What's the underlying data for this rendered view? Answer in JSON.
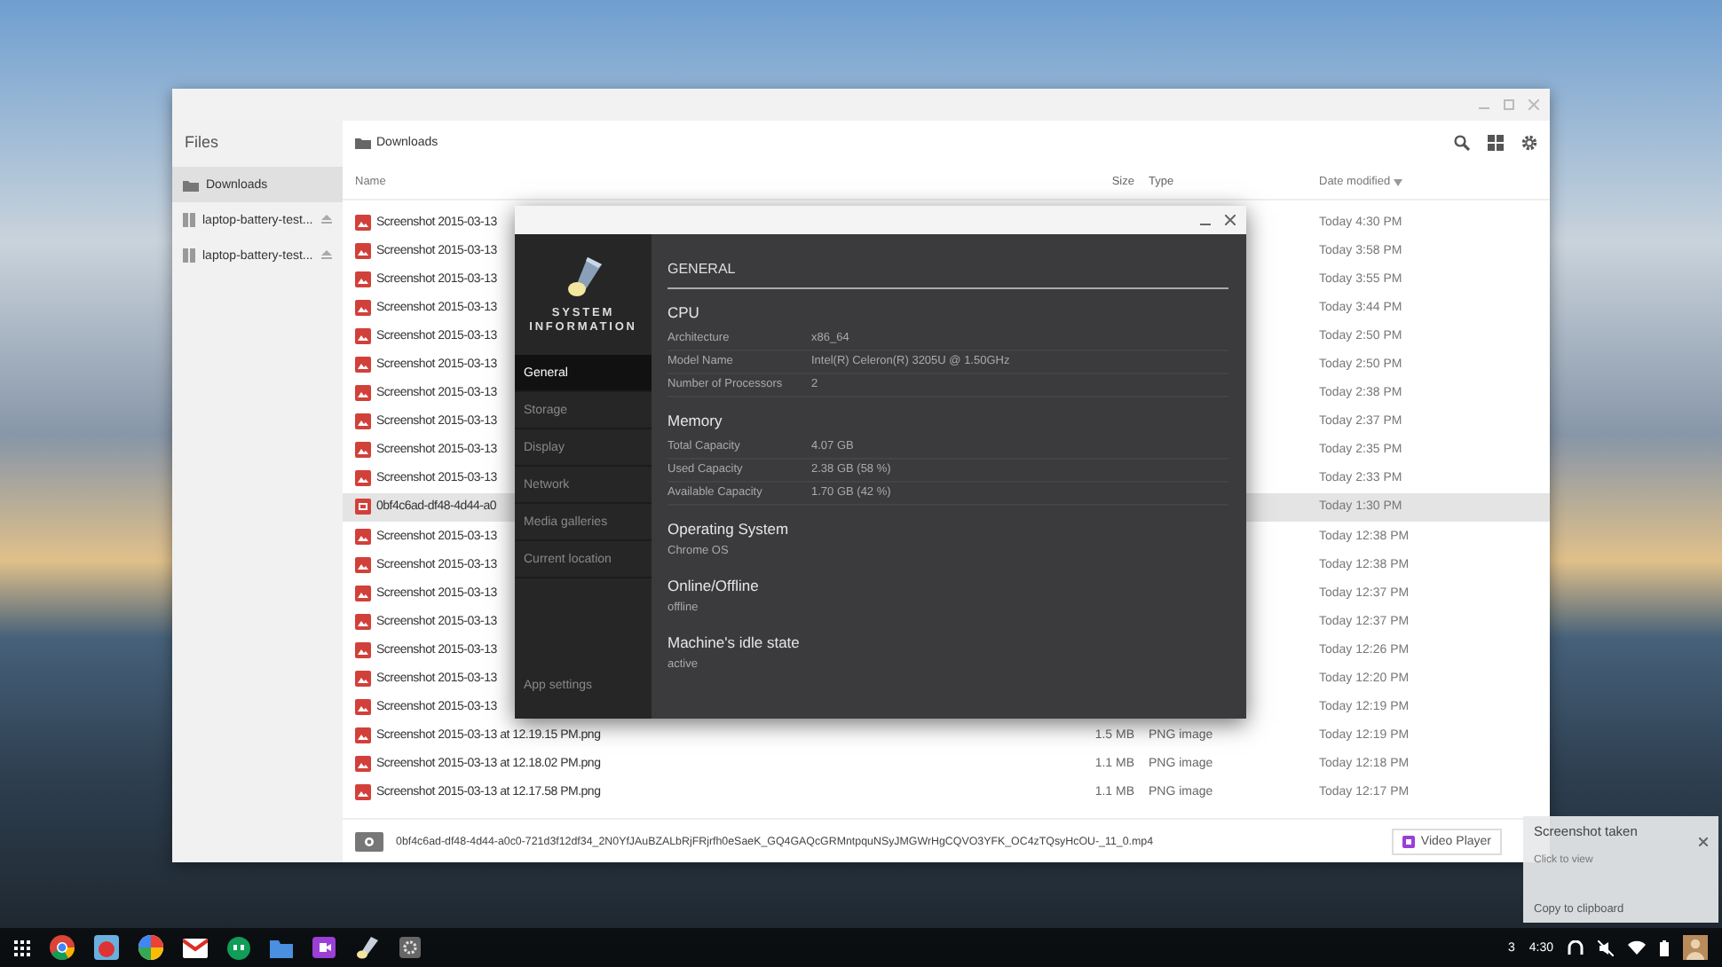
{
  "files_window": {
    "sidebar": {
      "title": "Files",
      "items": [
        {
          "label": "Downloads",
          "kind": "folder",
          "selected": true
        },
        {
          "label": "laptop-battery-test...",
          "kind": "drive",
          "selected": false
        },
        {
          "label": "laptop-battery-test...",
          "kind": "drive",
          "selected": false
        }
      ]
    },
    "breadcrumb": "Downloads",
    "columns": [
      "Name",
      "Size",
      "Type",
      "Date modified"
    ],
    "rows": [
      {
        "name": "Screenshot 2015-03-13",
        "kind": "image",
        "date": "Today 4:30 PM",
        "selected": false
      },
      {
        "name": "Screenshot 2015-03-13",
        "kind": "image",
        "date": "Today 3:58 PM",
        "selected": false
      },
      {
        "name": "Screenshot 2015-03-13",
        "kind": "image",
        "date": "Today 3:55 PM",
        "selected": false
      },
      {
        "name": "Screenshot 2015-03-13",
        "kind": "image",
        "date": "Today 3:44 PM",
        "selected": false
      },
      {
        "name": "Screenshot 2015-03-13",
        "kind": "image",
        "date": "Today 2:50 PM",
        "selected": false
      },
      {
        "name": "Screenshot 2015-03-13",
        "kind": "image",
        "date": "Today 2:50 PM",
        "selected": false
      },
      {
        "name": "Screenshot 2015-03-13",
        "kind": "image",
        "date": "Today 2:38 PM",
        "selected": false
      },
      {
        "name": "Screenshot 2015-03-13",
        "kind": "image",
        "date": "Today 2:37 PM",
        "selected": false
      },
      {
        "name": "Screenshot 2015-03-13",
        "kind": "image",
        "date": "Today 2:35 PM",
        "selected": false
      },
      {
        "name": "Screenshot 2015-03-13",
        "kind": "image",
        "date": "Today 2:33 PM",
        "selected": false
      },
      {
        "name": "0bf4c6ad-df48-4d44-a0",
        "kind": "video",
        "date": "Today 1:30 PM",
        "selected": true
      },
      {
        "name": "Screenshot 2015-03-13",
        "kind": "image",
        "date": "Today 12:38 PM",
        "selected": false
      },
      {
        "name": "Screenshot 2015-03-13",
        "kind": "image",
        "date": "Today 12:38 PM",
        "selected": false
      },
      {
        "name": "Screenshot 2015-03-13",
        "kind": "image",
        "date": "Today 12:37 PM",
        "selected": false
      },
      {
        "name": "Screenshot 2015-03-13",
        "kind": "image",
        "date": "Today 12:37 PM",
        "selected": false
      },
      {
        "name": "Screenshot 2015-03-13",
        "kind": "image",
        "date": "Today 12:26 PM",
        "selected": false
      },
      {
        "name": "Screenshot 2015-03-13",
        "kind": "image",
        "date": "Today 12:20 PM",
        "selected": false
      },
      {
        "name": "Screenshot 2015-03-13",
        "kind": "image",
        "date": "Today 12:19 PM",
        "selected": false
      },
      {
        "name": "Screenshot 2015-03-13 at 12.19.15 PM.png",
        "kind": "image",
        "size": "1.5 MB",
        "type": "PNG image",
        "date": "Today 12:19 PM",
        "selected": false
      },
      {
        "name": "Screenshot 2015-03-13 at 12.18.02 PM.png",
        "kind": "image",
        "size": "1.1 MB",
        "type": "PNG image",
        "date": "Today 12:18 PM",
        "selected": false
      },
      {
        "name": "Screenshot 2015-03-13 at 12.17.58 PM.png",
        "kind": "image",
        "size": "1.1 MB",
        "type": "PNG image",
        "date": "Today 12:17 PM",
        "selected": false
      }
    ],
    "footer": {
      "filename": "0bf4c6ad-df48-4d44-a0c0-721d3f12df34_2N0YfJAuBZALbRjFRjrfh0eSaeK_GQ4GAQcGRMntpquNSyJMGWrHgCQVO3YFK_OC4zTQsyHcOU-_11_0.mp4",
      "open_button": "Video Player"
    }
  },
  "sysinfo_dialog": {
    "app_name": "SYSTEM INFORMATION",
    "nav": [
      {
        "label": "General",
        "selected": true
      },
      {
        "label": "Storage",
        "selected": false
      },
      {
        "label": "Display",
        "selected": false
      },
      {
        "label": "Network",
        "selected": false
      },
      {
        "label": "Media galleries",
        "selected": false
      },
      {
        "label": "Current location",
        "selected": false
      }
    ],
    "settings": "App settings",
    "heading": "GENERAL",
    "sections": [
      {
        "title": "CPU",
        "rows": [
          {
            "label": "Architecture",
            "value": "x86_64"
          },
          {
            "label": "Model Name",
            "value": "Intel(R) Celeron(R) 3205U @ 1.50GHz"
          },
          {
            "label": "Number of Processors",
            "value": "2"
          }
        ]
      },
      {
        "title": "Memory",
        "rows": [
          {
            "label": "Total Capacity",
            "value": "4.07 GB"
          },
          {
            "label": "Used Capacity",
            "value": "2.38 GB (58 %)"
          },
          {
            "label": "Available Capacity",
            "value": "1.70 GB (42 %)"
          }
        ]
      },
      {
        "title": "Operating System",
        "value": "Chrome OS"
      },
      {
        "title": "Online/Offline",
        "value": "offline"
      },
      {
        "title": "Machine's idle state",
        "value": "active"
      }
    ]
  },
  "notification": {
    "title": "Screenshot taken",
    "subtitle": "Click to view",
    "action": "Copy to clipboard"
  },
  "taskbar": {
    "badge": "3",
    "time": "4:30"
  }
}
